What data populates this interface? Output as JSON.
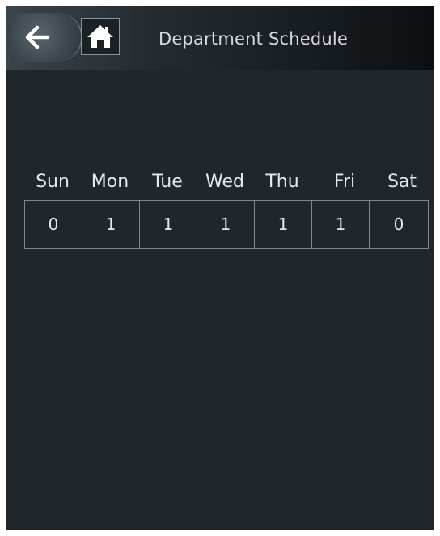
{
  "header": {
    "title": "Department Schedule",
    "back_icon": "arrow-left-icon",
    "home_icon": "home-icon"
  },
  "schedule": {
    "days": [
      {
        "label": "Sun",
        "value": "0"
      },
      {
        "label": "Mon",
        "value": "1"
      },
      {
        "label": "Tue",
        "value": "1"
      },
      {
        "label": "Wed",
        "value": "1"
      },
      {
        "label": "Thu",
        "value": "1"
      },
      {
        "label": "Fri",
        "value": "1"
      },
      {
        "label": "Sat",
        "value": "0"
      }
    ]
  },
  "colors": {
    "background": "#1f262c",
    "text": "#e4e8ea",
    "border": "#7d878d"
  }
}
